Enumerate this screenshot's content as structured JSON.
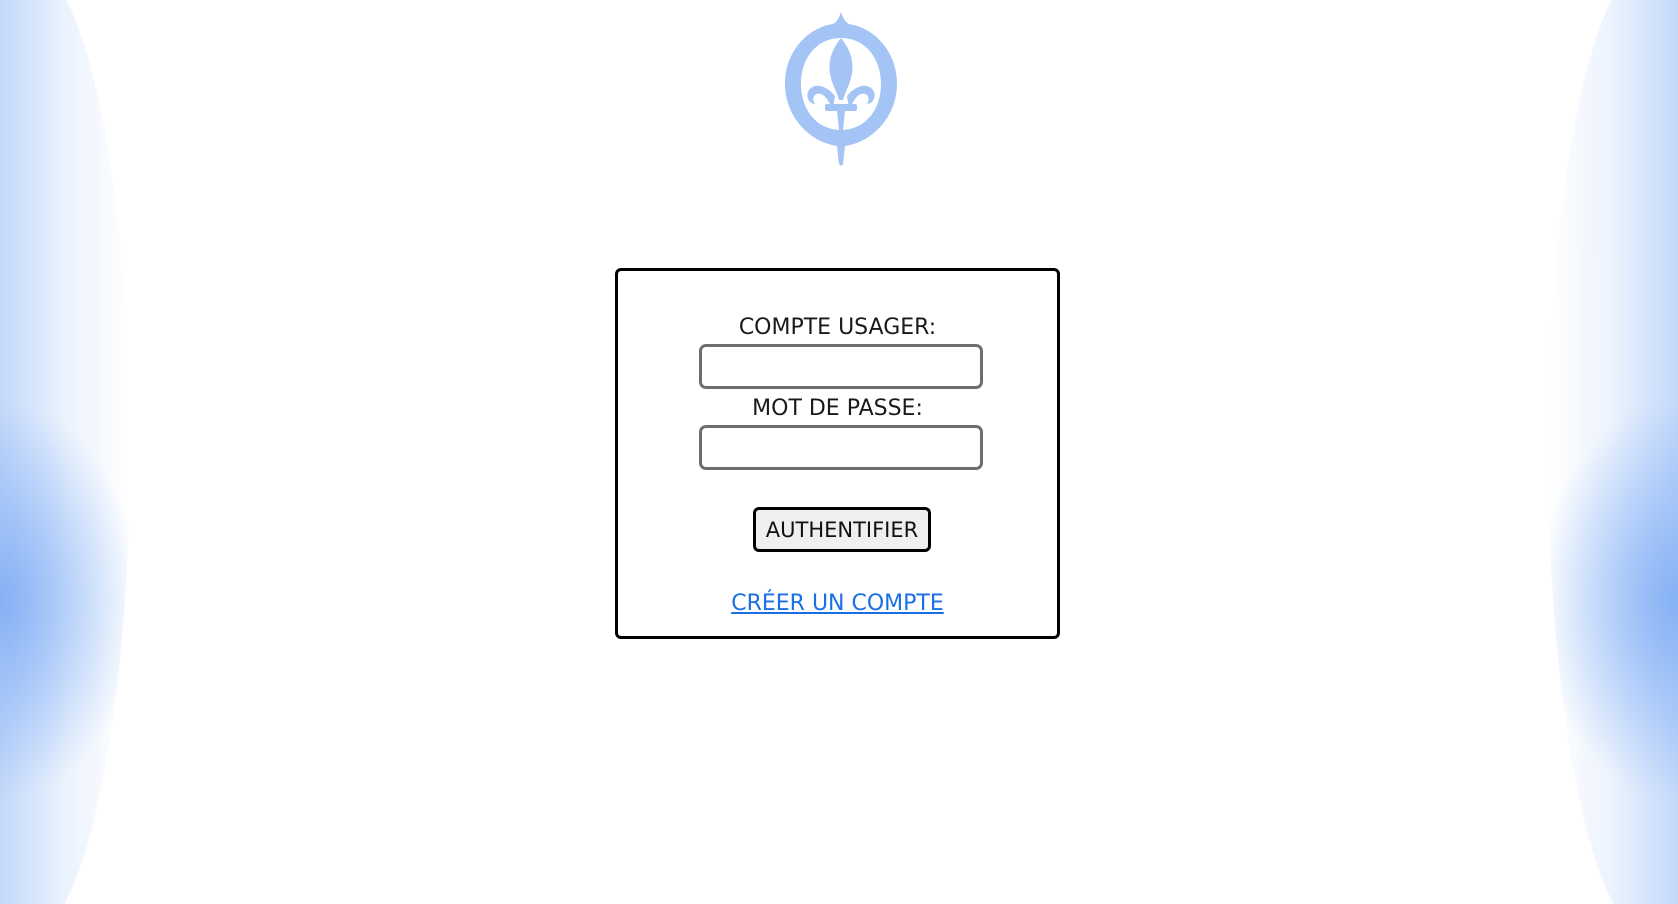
{
  "logo": {
    "icon": "fleur-de-lis-emblem-icon",
    "color": "#a3c4f5"
  },
  "login": {
    "username_label": "COMPTE USAGER:",
    "username_value": "",
    "password_label": "MOT DE PASSE:",
    "password_value": "",
    "submit_label": "AUTHENTIFIER",
    "create_account_label": "CRÉER UN COMPTE"
  },
  "colors": {
    "link": "#1a6fe6",
    "glow": "#96bef5",
    "button_bg": "#efefef"
  }
}
